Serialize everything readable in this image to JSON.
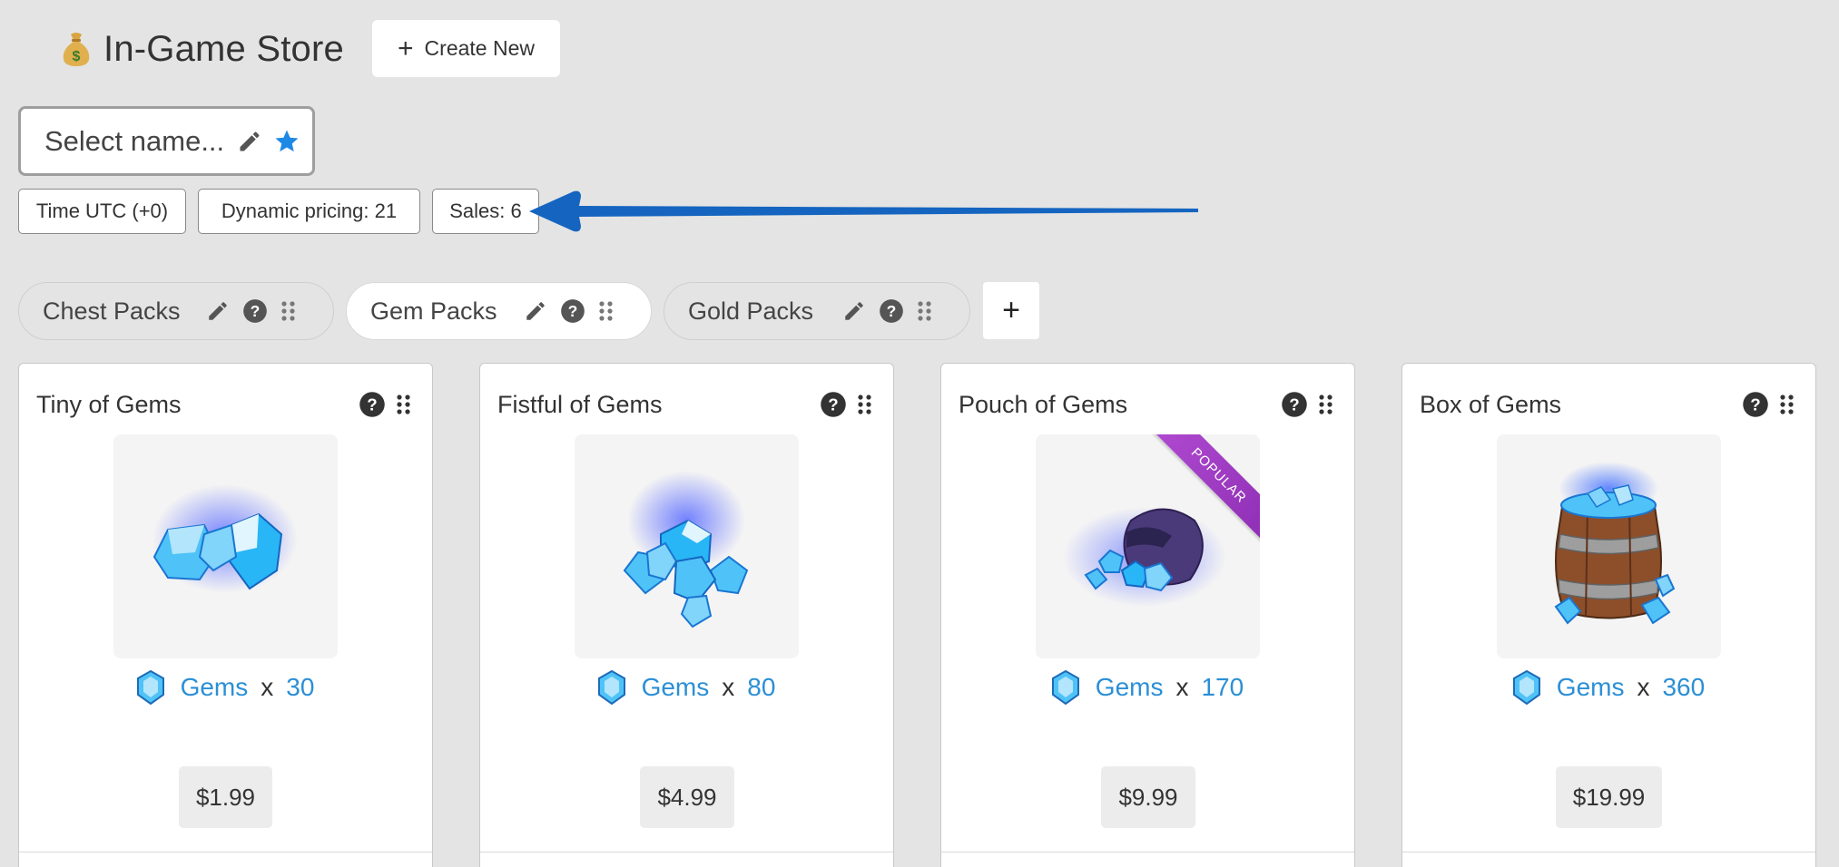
{
  "header": {
    "title": "In-Game Store",
    "title_icon": "money-bag-icon",
    "create_label": "Create New"
  },
  "name_selector": {
    "placeholder": "Select name..."
  },
  "info_chips": [
    {
      "label": "Time UTC (+0)"
    },
    {
      "label": "Dynamic pricing: 21"
    },
    {
      "label": "Sales: 6"
    }
  ],
  "tabs": [
    {
      "label": "Chest Packs",
      "active": false
    },
    {
      "label": "Gem Packs",
      "active": true
    },
    {
      "label": "Gold Packs",
      "active": false
    }
  ],
  "add_tab_label": "+",
  "cards": [
    {
      "title": "Tiny of Gems",
      "reward_name": "Gems",
      "reward_sep": "x",
      "reward_qty": "30",
      "price": "$1.99",
      "badge": ""
    },
    {
      "title": "Fistful of Gems",
      "reward_name": "Gems",
      "reward_sep": "x",
      "reward_qty": "80",
      "price": "$4.99",
      "badge": ""
    },
    {
      "title": "Pouch of Gems",
      "reward_name": "Gems",
      "reward_sep": "x",
      "reward_qty": "170",
      "price": "$9.99",
      "badge": "POPULAR"
    },
    {
      "title": "Box of Gems",
      "reward_name": "Gems",
      "reward_sep": "x",
      "reward_qty": "360",
      "price": "$19.99",
      "badge": ""
    }
  ],
  "colors": {
    "accent_blue": "#2b8fd6",
    "arrow_blue": "#1565c0",
    "ribbon_purple": "#9b3cc4",
    "background": "#e4e4e4"
  }
}
